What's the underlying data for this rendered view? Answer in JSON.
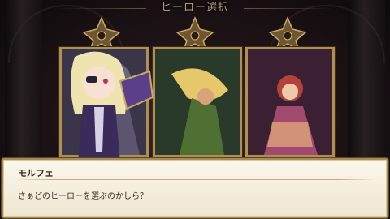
{
  "screen": {
    "title": "ヒーロー選択"
  },
  "heroes": [
    {
      "name": "hero-card-1",
      "palette": [
        "#3a3548",
        "#8c8aa4",
        "#e2dcc0"
      ]
    },
    {
      "name": "hero-card-2",
      "palette": [
        "#2a3a2a",
        "#6f8d45",
        "#e6c86a"
      ]
    },
    {
      "name": "hero-card-3",
      "palette": [
        "#3b1f33",
        "#a04a70",
        "#e6b07a"
      ]
    }
  ],
  "dialog": {
    "speaker": "モルフェ",
    "text": "さぁどのヒーローを選ぶのかしら？"
  },
  "colors": {
    "frame_gold": "#b08f52",
    "title_text": "#b69a86",
    "dialog_bg": "#f6f0e0",
    "dialog_text": "#3b2a1c"
  }
}
